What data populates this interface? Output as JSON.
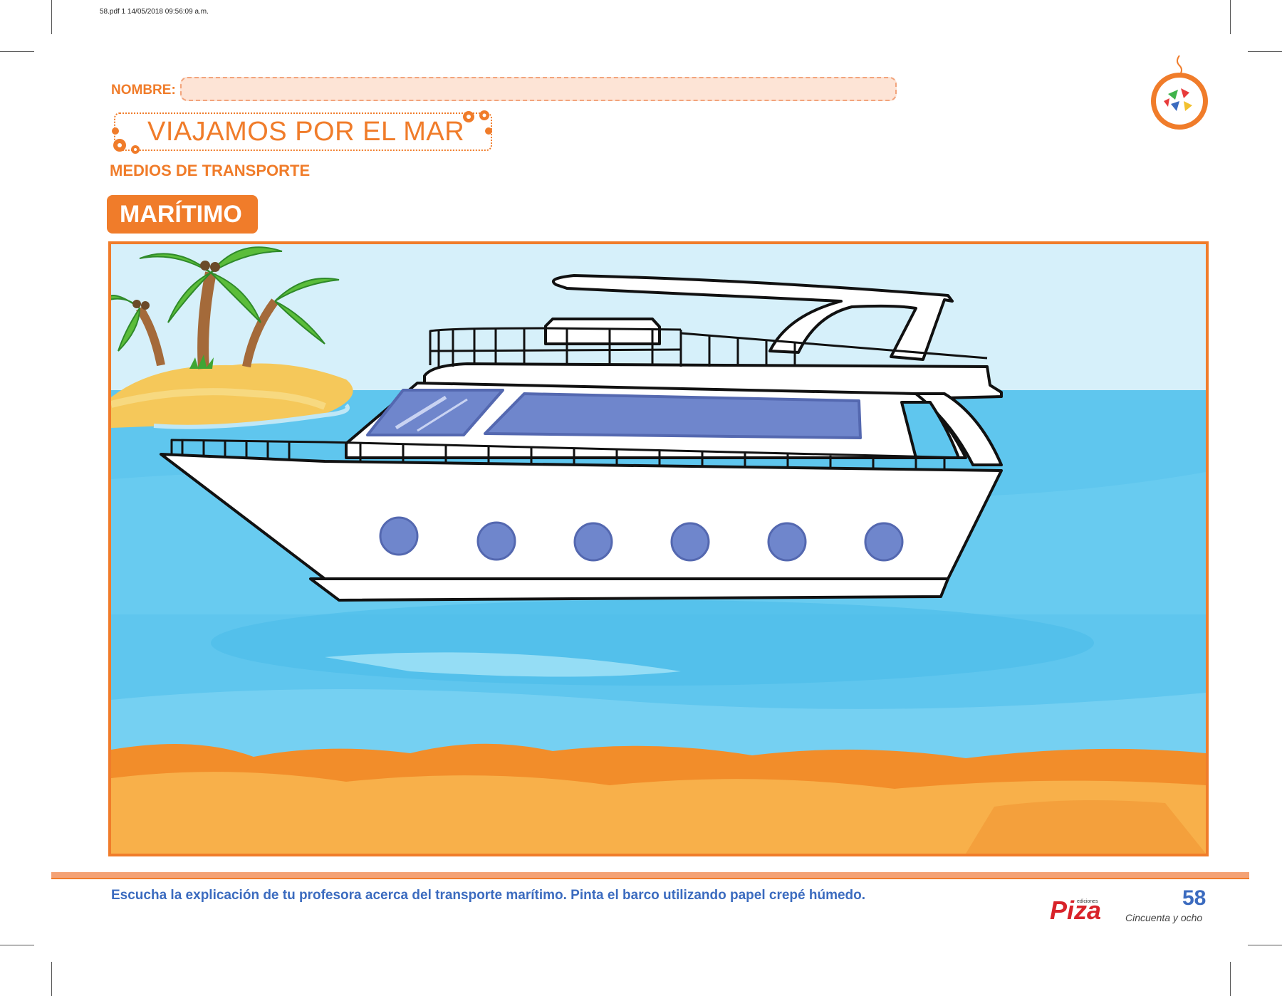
{
  "print_info": "58.pdf   1   14/05/2018   09:56:09 a.m.",
  "header": {
    "name_label": "NOMBRE:",
    "name_value": "",
    "title": "VIAJAMOS POR EL MAR",
    "subtitle": "MEDIOS DE TRANSPORTE"
  },
  "section_badge": "MARÍTIMO",
  "scene": {
    "sky_color": "#d6f0fa",
    "sea_color": "#5fc6ee",
    "sand_color": "#f7a94a",
    "border_color": "#f07c2a",
    "window_color": "#6f86cc",
    "porthole_count": 6
  },
  "footer": {
    "instruction": "Escucha la explicación de tu profesora acerca del transporte marítimo. Pinta el barco utilizando papel crepé húmedo.",
    "publisher": "Piza",
    "publisher_small": "ediciones",
    "page_number": "58",
    "page_number_words": "Cincuenta y ocho"
  },
  "colors": {
    "accent": "#f07c2a",
    "text_blue": "#3b6bbf"
  }
}
